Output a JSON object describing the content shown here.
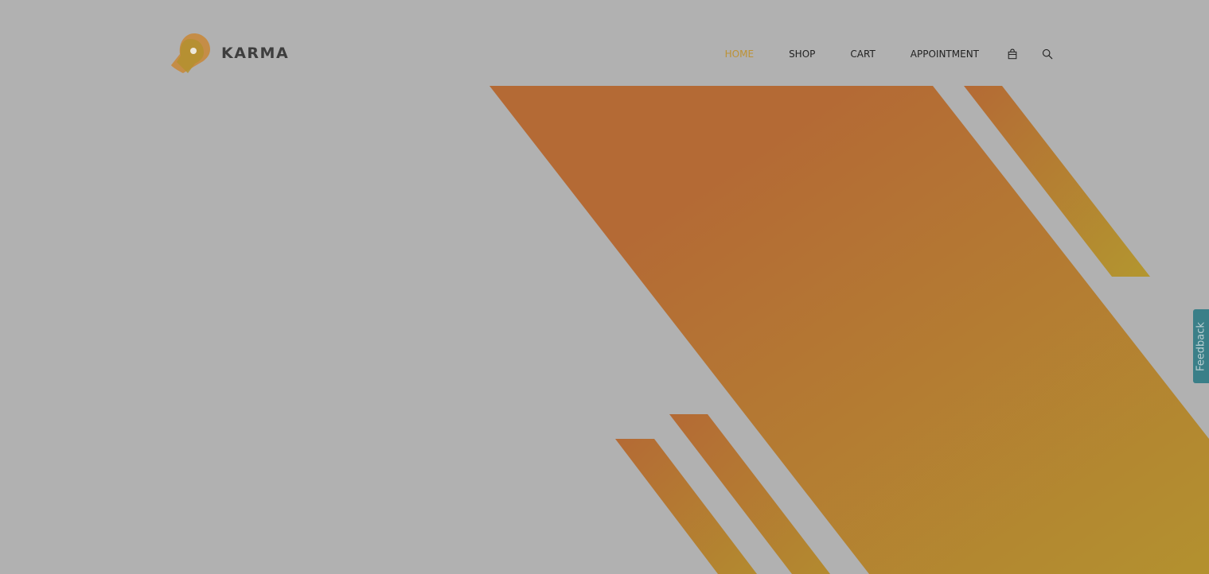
{
  "brand": {
    "name": "KARMA",
    "logo_icon": "map-pin-logo-icon"
  },
  "nav": {
    "items": [
      {
        "label": "Home",
        "active": true
      },
      {
        "label": "Shop",
        "active": false
      },
      {
        "label": "Cart",
        "active": false
      },
      {
        "label": "Appointment",
        "active": false
      }
    ],
    "icons": [
      "shopping-bag-icon",
      "search-icon"
    ]
  },
  "feedback": {
    "label": "Feedback"
  },
  "colors": {
    "background": "#b1b1b1",
    "accent": "#bd9235",
    "stripe_start": "#b46a35",
    "stripe_end": "#b3912f",
    "feedback_tab": "#3a7f88"
  }
}
